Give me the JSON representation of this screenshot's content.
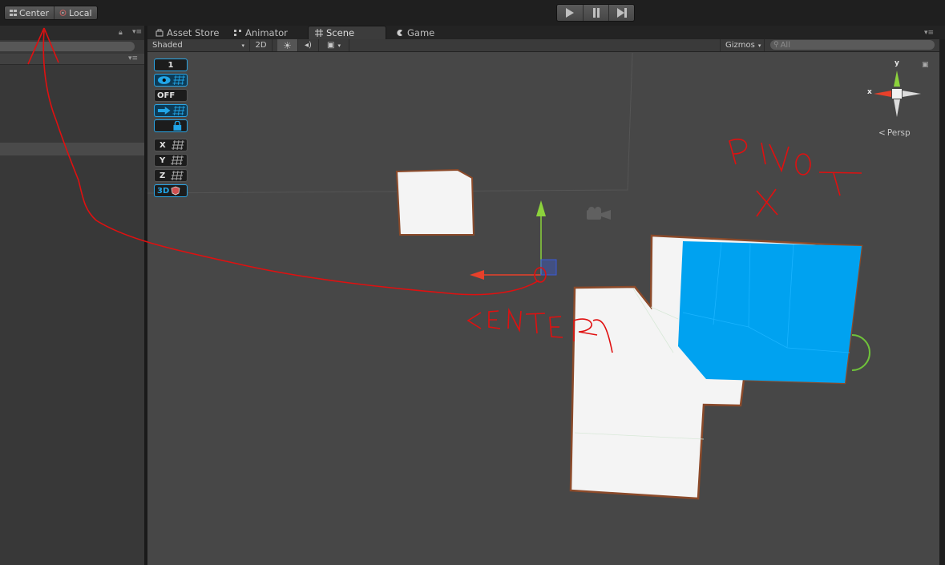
{
  "toolbar": {
    "pivot_center_label": "Center",
    "pivot_local_label": "Local"
  },
  "tabs": {
    "asset_store": "Asset Store",
    "animator": "Animator",
    "scene": "Scene",
    "game": "Game"
  },
  "scene_toolbar": {
    "shading_mode": "Shaded",
    "mode_2d": "2D",
    "gizmos_label": "Gizmos",
    "search_placeholder": "All"
  },
  "scene_tools": {
    "layer_value": "1",
    "off_label": "OFF",
    "axis_x": "X",
    "axis_y": "Y",
    "axis_z": "Z",
    "mode_3d": "3D"
  },
  "orientation_gizmo": {
    "y_label": "y",
    "x_label": "x",
    "projection_label": "Persp"
  },
  "annotations": {
    "pivot_text": "PIVOT",
    "center_text": "CENTER",
    "color": "#e01010"
  },
  "colors": {
    "selection_blue": "#00a2f0",
    "outline_brown": "#8b4a2a",
    "y_axis_green": "#8cd23c",
    "x_axis_red": "#e8402a"
  }
}
